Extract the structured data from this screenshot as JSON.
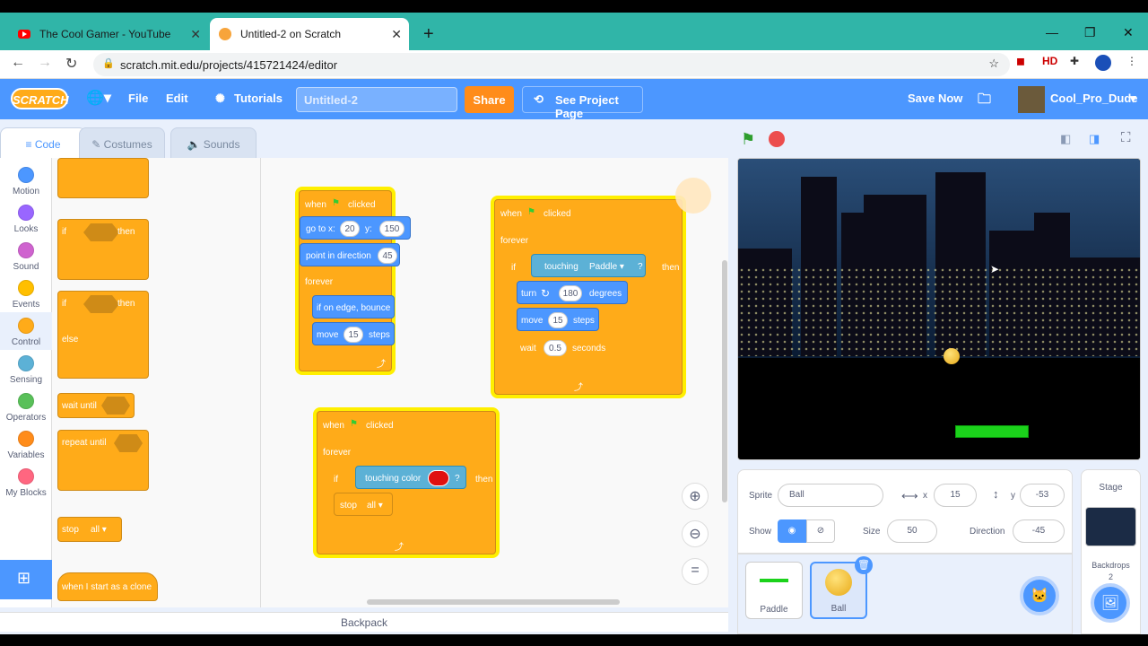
{
  "browser": {
    "tabs": [
      {
        "title": "The Cool Gamer - YouTube"
      },
      {
        "title": "Untitled-2 on Scratch"
      }
    ],
    "url": "scratch.mit.edu/projects/415721424/editor",
    "ext_hd": "HD"
  },
  "menu": {
    "logo": "SCRATCH",
    "file": "File",
    "edit": "Edit",
    "tutorials": "Tutorials",
    "project_title": "Untitled-2",
    "share": "Share",
    "see_project": "See Project Page",
    "save_now": "Save Now",
    "username": "Cool_Pro_Dude"
  },
  "editor_tabs": {
    "code": "Code",
    "costumes": "Costumes",
    "sounds": "Sounds"
  },
  "categories": [
    {
      "label": "Motion",
      "color": "#4c97ff"
    },
    {
      "label": "Looks",
      "color": "#9966ff"
    },
    {
      "label": "Sound",
      "color": "#cf63cf"
    },
    {
      "label": "Events",
      "color": "#ffbf00"
    },
    {
      "label": "Control",
      "color": "#ffab19"
    },
    {
      "label": "Sensing",
      "color": "#5cb1d6"
    },
    {
      "label": "Operators",
      "color": "#59c059"
    },
    {
      "label": "Variables",
      "color": "#ff8c1a"
    },
    {
      "label": "My Blocks",
      "color": "#ff6680"
    }
  ],
  "palette": {
    "if": "if",
    "then": "then",
    "else": "else",
    "wait_until": "wait until",
    "repeat_until": "repeat until",
    "stop": "stop",
    "all": "all",
    "clone": "when I start as a clone"
  },
  "script1": {
    "hat": "when",
    "clicked": "clicked",
    "goto": "go to x:",
    "x": "20",
    "y_label": "y:",
    "y": "150",
    "point": "point in direction",
    "dir": "45",
    "forever": "forever",
    "bounce": "if on edge, bounce",
    "move": "move",
    "steps_val": "15",
    "steps": "steps"
  },
  "script2": {
    "hat": "when",
    "clicked": "clicked",
    "forever": "forever",
    "if": "if",
    "touching": "touching",
    "target": "Paddle",
    "q": "?",
    "then": "then",
    "turn": "turn",
    "deg_val": "180",
    "degrees": "degrees",
    "move": "move",
    "steps_val": "15",
    "steps": "steps",
    "wait": "wait",
    "wait_val": "0.5",
    "seconds": "seconds"
  },
  "script3": {
    "hat": "when",
    "clicked": "clicked",
    "forever": "forever",
    "if": "if",
    "touching_color": "touching color",
    "q": "?",
    "then": "then",
    "stop": "stop",
    "all": "all"
  },
  "sprite_info": {
    "sprite_label": "Sprite",
    "sprite_name": "Ball",
    "x_label": "x",
    "x": "15",
    "y_label": "y",
    "y": "-53",
    "show_label": "Show",
    "size_label": "Size",
    "size": "50",
    "direction_label": "Direction",
    "direction": "-45"
  },
  "sprites": [
    {
      "name": "Paddle"
    },
    {
      "name": "Ball"
    }
  ],
  "stage_panel": {
    "title": "Stage",
    "backdrops_label": "Backdrops",
    "backdrops_count": "2"
  },
  "backpack": "Backpack"
}
